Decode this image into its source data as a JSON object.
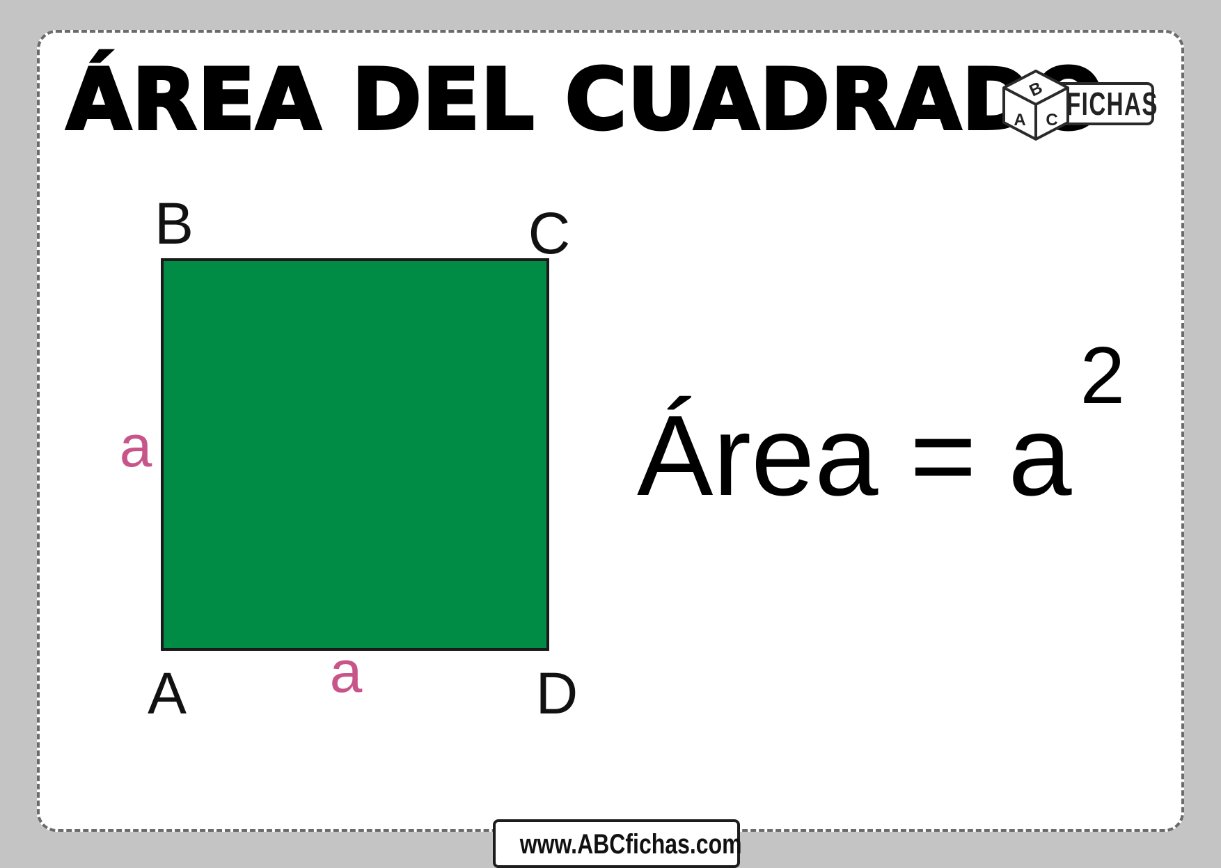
{
  "title": "ÁREA DEL CUADRADO",
  "logo": {
    "text": "FICHAS",
    "cube_letters": [
      "B",
      "A",
      "C"
    ]
  },
  "diagram": {
    "fill_color": "#008c45",
    "side_label_color": "#c8558a",
    "vertices": {
      "top_left": "B",
      "top_right": "C",
      "bottom_left": "A",
      "bottom_right": "D"
    },
    "side_labels": {
      "left": "a",
      "bottom": "a"
    }
  },
  "formula": {
    "lhs": "Área = a",
    "exponent": "2"
  },
  "footer": {
    "url": "www.ABCfichas.com"
  }
}
